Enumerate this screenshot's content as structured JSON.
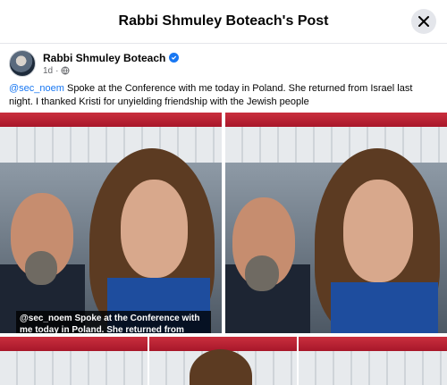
{
  "header": {
    "title": "Rabbi Shmuley Boteach's Post",
    "close_icon": "close-icon"
  },
  "post": {
    "author": "Rabbi Shmuley Boteach",
    "verified_icon": "verified-badge-icon",
    "time": "1d",
    "audience_icon": "globe-icon",
    "mention": "@sec_noem",
    "text": " Spoke at the Conference with me today in Poland. She returned from Israel last night. I thanked Kristi for unyielding friendship with the Jewish people"
  },
  "photos": {
    "caption_line1": "@sec_noem  Spoke at the Conference with",
    "caption_line2": "me today in Poland. She returned from Israel"
  },
  "colors": {
    "accent": "#1877f2",
    "banner_red": "#c92f3e"
  }
}
